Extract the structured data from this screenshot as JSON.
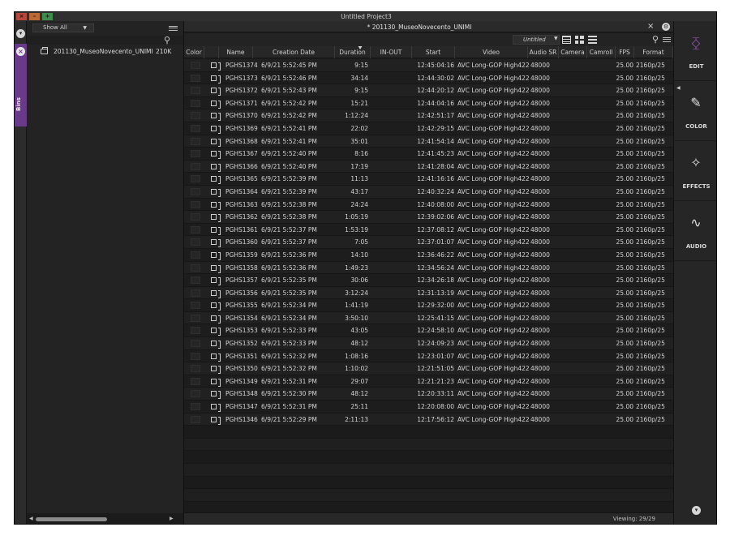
{
  "window": {
    "title": "Untitled Project3"
  },
  "bins": {
    "tab_label": "Bins",
    "filter_value": "Show All",
    "items": [
      {
        "name": "201130_MuseoNovecento_UNIMI",
        "size": "210K"
      }
    ]
  },
  "main": {
    "tab_title": "* 201130_MuseoNovecento_UNIMI",
    "view_select": "Untitled",
    "status": "Viewing: 29/29",
    "columns": [
      {
        "key": "color",
        "label": "Color"
      },
      {
        "key": "icon",
        "label": ""
      },
      {
        "key": "name",
        "label": "Name"
      },
      {
        "key": "created",
        "label": "Creation Date"
      },
      {
        "key": "duration",
        "label": "Duration"
      },
      {
        "key": "inout",
        "label": "IN-OUT"
      },
      {
        "key": "start",
        "label": "Start"
      },
      {
        "key": "video",
        "label": "Video"
      },
      {
        "key": "audio_sr",
        "label": "Audio SR"
      },
      {
        "key": "camera",
        "label": "Camera"
      },
      {
        "key": "camroll",
        "label": "Camroll"
      },
      {
        "key": "fps",
        "label": "FPS"
      },
      {
        "key": "format",
        "label": "Format"
      }
    ],
    "rows": [
      {
        "name": "PGHS1374",
        "created": "6/9/21 5:52:45 PM",
        "duration": "9:15",
        "start": "12:45:04:16",
        "video": "AVC Long-GOP High422",
        "audio_sr": "48000",
        "fps": "25.00",
        "format": "2160p/25"
      },
      {
        "name": "PGHS1373",
        "created": "6/9/21 5:52:46 PM",
        "duration": "34:14",
        "start": "12:44:30:02",
        "video": "AVC Long-GOP High422",
        "audio_sr": "48000",
        "fps": "25.00",
        "format": "2160p/25"
      },
      {
        "name": "PGHS1372",
        "created": "6/9/21 5:52:43 PM",
        "duration": "9:15",
        "start": "12:44:20:12",
        "video": "AVC Long-GOP High422",
        "audio_sr": "48000",
        "fps": "25.00",
        "format": "2160p/25"
      },
      {
        "name": "PGHS1371",
        "created": "6/9/21 5:52:42 PM",
        "duration": "15:21",
        "start": "12:44:04:16",
        "video": "AVC Long-GOP High422",
        "audio_sr": "48000",
        "fps": "25.00",
        "format": "2160p/25"
      },
      {
        "name": "PGHS1370",
        "created": "6/9/21 5:52:42 PM",
        "duration": "1:12:24",
        "start": "12:42:51:17",
        "video": "AVC Long-GOP High422",
        "audio_sr": "48000",
        "fps": "25.00",
        "format": "2160p/25"
      },
      {
        "name": "PGHS1369",
        "created": "6/9/21 5:52:41 PM",
        "duration": "22:02",
        "start": "12:42:29:15",
        "video": "AVC Long-GOP High422",
        "audio_sr": "48000",
        "fps": "25.00",
        "format": "2160p/25"
      },
      {
        "name": "PGHS1368",
        "created": "6/9/21 5:52:41 PM",
        "duration": "35:01",
        "start": "12:41:54:14",
        "video": "AVC Long-GOP High422",
        "audio_sr": "48000",
        "fps": "25.00",
        "format": "2160p/25"
      },
      {
        "name": "PGHS1367",
        "created": "6/9/21 5:52:40 PM",
        "duration": "8:16",
        "start": "12:41:45:23",
        "video": "AVC Long-GOP High422",
        "audio_sr": "48000",
        "fps": "25.00",
        "format": "2160p/25"
      },
      {
        "name": "PGHS1366",
        "created": "6/9/21 5:52:40 PM",
        "duration": "17:19",
        "start": "12:41:28:04",
        "video": "AVC Long-GOP High422",
        "audio_sr": "48000",
        "fps": "25.00",
        "format": "2160p/25"
      },
      {
        "name": "PGHS1365",
        "created": "6/9/21 5:52:39 PM",
        "duration": "11:13",
        "start": "12:41:16:16",
        "video": "AVC Long-GOP High422",
        "audio_sr": "48000",
        "fps": "25.00",
        "format": "2160p/25"
      },
      {
        "name": "PGHS1364",
        "created": "6/9/21 5:52:39 PM",
        "duration": "43:17",
        "start": "12:40:32:24",
        "video": "AVC Long-GOP High422",
        "audio_sr": "48000",
        "fps": "25.00",
        "format": "2160p/25"
      },
      {
        "name": "PGHS1363",
        "created": "6/9/21 5:52:38 PM",
        "duration": "24:24",
        "start": "12:40:08:00",
        "video": "AVC Long-GOP High422",
        "audio_sr": "48000",
        "fps": "25.00",
        "format": "2160p/25"
      },
      {
        "name": "PGHS1362",
        "created": "6/9/21 5:52:38 PM",
        "duration": "1:05:19",
        "start": "12:39:02:06",
        "video": "AVC Long-GOP High422",
        "audio_sr": "48000",
        "fps": "25.00",
        "format": "2160p/25"
      },
      {
        "name": "PGHS1361",
        "created": "6/9/21 5:52:37 PM",
        "duration": "1:53:19",
        "start": "12:37:08:12",
        "video": "AVC Long-GOP High422",
        "audio_sr": "48000",
        "fps": "25.00",
        "format": "2160p/25"
      },
      {
        "name": "PGHS1360",
        "created": "6/9/21 5:52:37 PM",
        "duration": "7:05",
        "start": "12:37:01:07",
        "video": "AVC Long-GOP High422",
        "audio_sr": "48000",
        "fps": "25.00",
        "format": "2160p/25"
      },
      {
        "name": "PGHS1359",
        "created": "6/9/21 5:52:36 PM",
        "duration": "14:10",
        "start": "12:36:46:22",
        "video": "AVC Long-GOP High422",
        "audio_sr": "48000",
        "fps": "25.00",
        "format": "2160p/25"
      },
      {
        "name": "PGHS1358",
        "created": "6/9/21 5:52:36 PM",
        "duration": "1:49:23",
        "start": "12:34:56:24",
        "video": "AVC Long-GOP High422",
        "audio_sr": "48000",
        "fps": "25.00",
        "format": "2160p/25"
      },
      {
        "name": "PGHS1357",
        "created": "6/9/21 5:52:35 PM",
        "duration": "30:06",
        "start": "12:34:26:18",
        "video": "AVC Long-GOP High422",
        "audio_sr": "48000",
        "fps": "25.00",
        "format": "2160p/25"
      },
      {
        "name": "PGHS1356",
        "created": "6/9/21 5:52:35 PM",
        "duration": "3:12:24",
        "start": "12:31:13:19",
        "video": "AVC Long-GOP High422",
        "audio_sr": "48000",
        "fps": "25.00",
        "format": "2160p/25"
      },
      {
        "name": "PGHS1355",
        "created": "6/9/21 5:52:34 PM",
        "duration": "1:41:19",
        "start": "12:29:32:00",
        "video": "AVC Long-GOP High422",
        "audio_sr": "48000",
        "fps": "25.00",
        "format": "2160p/25"
      },
      {
        "name": "PGHS1354",
        "created": "6/9/21 5:52:34 PM",
        "duration": "3:50:10",
        "start": "12:25:41:15",
        "video": "AVC Long-GOP High422",
        "audio_sr": "48000",
        "fps": "25.00",
        "format": "2160p/25"
      },
      {
        "name": "PGHS1353",
        "created": "6/9/21 5:52:33 PM",
        "duration": "43:05",
        "start": "12:24:58:10",
        "video": "AVC Long-GOP High422",
        "audio_sr": "48000",
        "fps": "25.00",
        "format": "2160p/25"
      },
      {
        "name": "PGHS1352",
        "created": "6/9/21 5:52:33 PM",
        "duration": "48:12",
        "start": "12:24:09:23",
        "video": "AVC Long-GOP High422",
        "audio_sr": "48000",
        "fps": "25.00",
        "format": "2160p/25"
      },
      {
        "name": "PGHS1351",
        "created": "6/9/21 5:52:32 PM",
        "duration": "1:08:16",
        "start": "12:23:01:07",
        "video": "AVC Long-GOP High422",
        "audio_sr": "48000",
        "fps": "25.00",
        "format": "2160p/25"
      },
      {
        "name": "PGHS1350",
        "created": "6/9/21 5:52:32 PM",
        "duration": "1:10:02",
        "start": "12:21:51:05",
        "video": "AVC Long-GOP High422",
        "audio_sr": "48000",
        "fps": "25.00",
        "format": "2160p/25"
      },
      {
        "name": "PGHS1349",
        "created": "6/9/21 5:52:31 PM",
        "duration": "29:07",
        "start": "12:21:21:23",
        "video": "AVC Long-GOP High422",
        "audio_sr": "48000",
        "fps": "25.00",
        "format": "2160p/25"
      },
      {
        "name": "PGHS1348",
        "created": "6/9/21 5:52:30 PM",
        "duration": "48:12",
        "start": "12:20:33:11",
        "video": "AVC Long-GOP High422",
        "audio_sr": "48000",
        "fps": "25.00",
        "format": "2160p/25"
      },
      {
        "name": "PGHS1347",
        "created": "6/9/21 5:52:31 PM",
        "duration": "25:11",
        "start": "12:20:08:00",
        "video": "AVC Long-GOP High422",
        "audio_sr": "48000",
        "fps": "25.00",
        "format": "2160p/25"
      },
      {
        "name": "PGHS1346",
        "created": "6/9/21 5:52:29 PM",
        "duration": "2:11:13",
        "start": "12:17:56:12",
        "video": "AVC Long-GOP High422",
        "audio_sr": "48000",
        "fps": "25.00",
        "format": "2160p/25"
      }
    ]
  },
  "pages": [
    {
      "id": "edit",
      "label": "EDIT",
      "icon": "edit-page-icon"
    },
    {
      "id": "color",
      "label": "COLOR",
      "icon": "color-page-icon"
    },
    {
      "id": "effects",
      "label": "EFFECTS",
      "icon": "effects-page-icon"
    },
    {
      "id": "audio",
      "label": "AUDIO",
      "icon": "audio-page-icon"
    }
  ],
  "colors": {
    "accent": "#6a3a8a",
    "edit_icon": "#b05ed6",
    "close": "#b8473d",
    "minimize": "#bb6a34",
    "maximize": "#3f8d4a"
  }
}
